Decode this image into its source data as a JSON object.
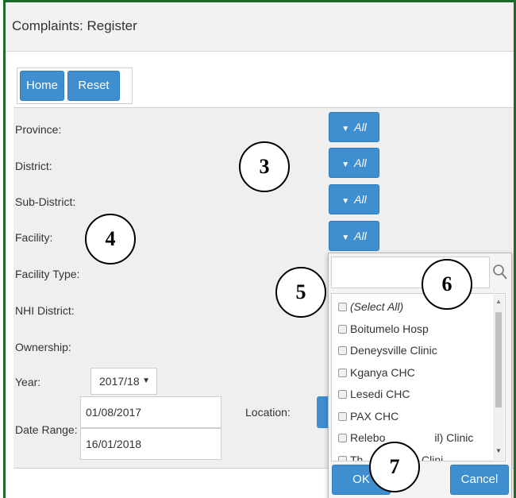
{
  "window": {
    "title": "Complaints: Register"
  },
  "toolbar": {
    "home_label": "Home",
    "reset_label": "Reset"
  },
  "filters": {
    "province_label": "Province:",
    "district_label": "District:",
    "subdistrict_label": "Sub-District:",
    "facility_label": "Facility:",
    "facility_type_label": "Facility Type:",
    "nhi_district_label": "NHI District:",
    "ownership_label": "Ownership:",
    "year_label": "Year:",
    "year_value": "2017/18",
    "date_range_label": "Date Range:",
    "date_from": "01/08/2017",
    "date_to": "16/01/2018",
    "location_label": "Location:",
    "filter_all_label": "All",
    "filter_icon": "funnel-icon"
  },
  "annotations": {
    "n3": "3",
    "n4": "4",
    "n5": "5",
    "n6": "6",
    "n7": "7"
  },
  "dropdown": {
    "search_placeholder": "",
    "items": [
      "(Select All)",
      "Boitumelo Hosp",
      "Deneysville Clinic",
      "Kganya CHC",
      "Lesedi CHC",
      "PAX CHC",
      "Relebo",
      "il) Clinic",
      "Th",
      "l) Clini"
    ],
    "ok_label": "OK",
    "cancel_label": "Cancel"
  },
  "colors": {
    "accent": "#3e8ed0",
    "frame": "#1f6a2b",
    "panel": "#efefef"
  }
}
